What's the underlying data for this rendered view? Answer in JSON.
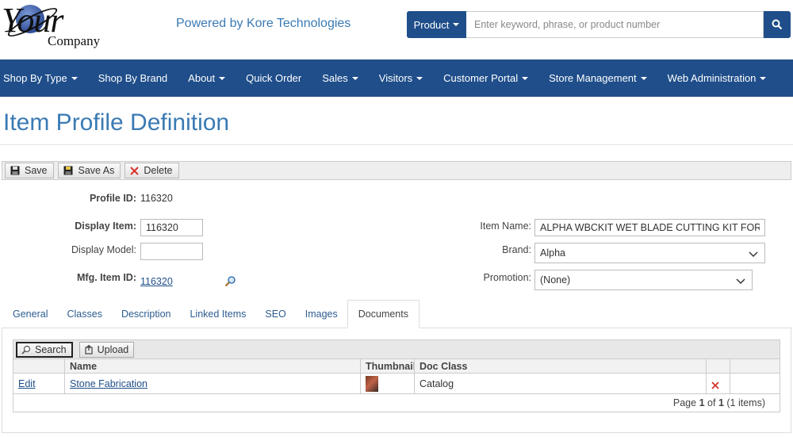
{
  "brand": {
    "logo_main": "Your",
    "logo_sub": "Company",
    "tagline": "Powered by Kore Technologies"
  },
  "search": {
    "category": "Product",
    "placeholder": "Enter keyword, phrase, or product number"
  },
  "nav": [
    "Shop By Type",
    "Shop By Brand",
    "About",
    "Quick Order",
    "Sales",
    "Visitors",
    "Customer Portal",
    "Store Management",
    "Web Administration"
  ],
  "nav_has_caret": [
    true,
    false,
    true,
    false,
    true,
    true,
    true,
    true,
    true
  ],
  "page": {
    "title": "Item Profile Definition"
  },
  "toolbar": {
    "save": "Save",
    "save_as": "Save As",
    "delete": "Delete"
  },
  "form": {
    "profile_id_label": "Profile ID:",
    "profile_id_value": "116320",
    "display_item_label": "Display Item:",
    "display_item_value": "116320",
    "display_model_label": "Display Model:",
    "display_model_value": "",
    "mfg_item_label": "Mfg. Item ID:",
    "mfg_item_value": "116320",
    "item_name_label": "Item Name:",
    "item_name_value": "ALPHA WBCKIT WET BLADE CUTTING KIT FOR H",
    "brand_label": "Brand:",
    "brand_value": "Alpha",
    "promotion_label": "Promotion:",
    "promotion_value": "(None)"
  },
  "tabs": [
    "General",
    "Classes",
    "Description",
    "Linked Items",
    "SEO",
    "Images",
    "Documents"
  ],
  "active_tab": "Documents",
  "documents": {
    "search_label": "Search",
    "upload_label": "Upload",
    "columns": [
      "",
      "Name",
      "Thumbnail",
      "Doc Class",
      "",
      ""
    ],
    "rows": [
      {
        "action": "Edit",
        "name": "Stone Fabrication",
        "doc_class": "Catalog"
      }
    ],
    "pager": {
      "prefix": "Page",
      "page": "1",
      "of": "of",
      "total": "1",
      "items": "(1 items)"
    }
  },
  "colors": {
    "brand_blue": "#1f4e8a",
    "title_blue": "#3a7ab4",
    "delete_red": "#d9342b"
  }
}
